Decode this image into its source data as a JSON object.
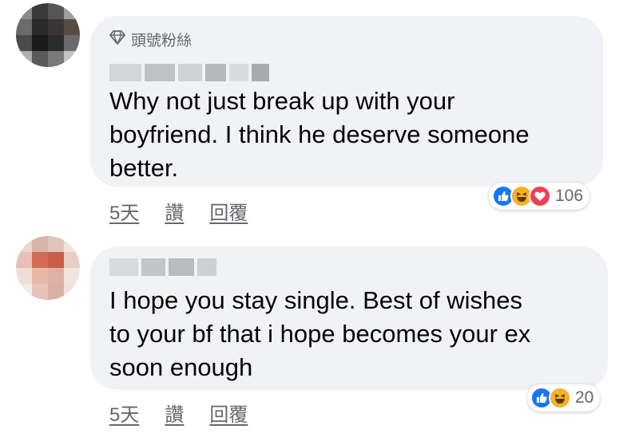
{
  "comments": [
    {
      "badge": "頭號粉絲",
      "text_lines": [
        "Why not just break up with your",
        "boyfriend. I think he deserve someone",
        "better."
      ],
      "time": "5天",
      "like": "讚",
      "reply": "回覆",
      "reaction_count": "106",
      "reactions": [
        "like-icon",
        "haha-icon",
        "love-icon"
      ]
    },
    {
      "text_lines": [
        "I hope you stay single. Best of wishes",
        "to your bf that i hope becomes your ex",
        "soon enough"
      ],
      "time": "5天",
      "like": "讚",
      "reply": "回覆",
      "reaction_count": "20",
      "reactions": [
        "like-icon",
        "haha-icon"
      ]
    }
  ],
  "colors": {
    "bubble": "#f0f2f5",
    "meta_text": "#65676b",
    "like": "#1877f2",
    "haha": "#f7b125",
    "love": "#f33e58"
  }
}
